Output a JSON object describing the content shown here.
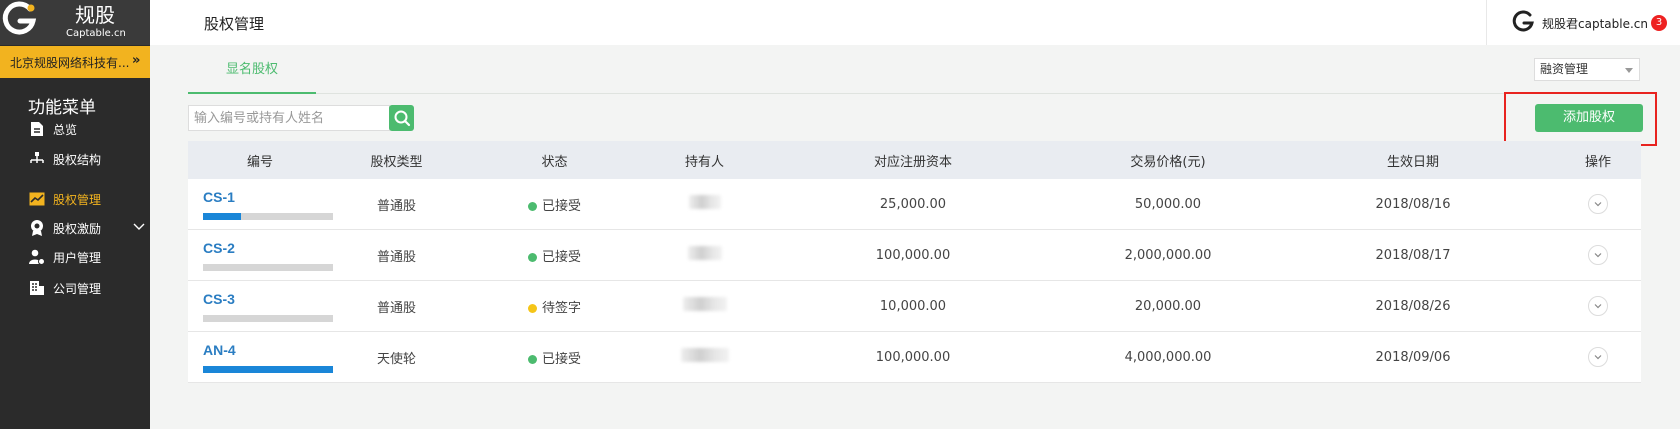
{
  "brand": {
    "name": "规股",
    "domain": "Captable.cn",
    "accent": "#f2b31f"
  },
  "company": {
    "name": "北京规股网络科技有...",
    "toggle_icon": "double-chevron-right-icon"
  },
  "sidebar": {
    "title": "功能菜单",
    "items": [
      {
        "label": "总览",
        "icon": "document-icon",
        "active": false
      },
      {
        "label": "股权结构",
        "icon": "org-chart-icon",
        "active": false
      },
      {
        "label": "股权管理",
        "icon": "trend-chart-icon",
        "active": true
      },
      {
        "label": "股权激励",
        "icon": "award-icon",
        "active": false,
        "expandable": true
      },
      {
        "label": "用户管理",
        "icon": "user-settings-icon",
        "active": false
      },
      {
        "label": "公司管理",
        "icon": "building-icon",
        "active": false
      }
    ]
  },
  "header": {
    "title": "股权管理",
    "user_name": "规股君captable.cn",
    "notification_count": "3"
  },
  "tabs": [
    {
      "label": "显名股权",
      "active": true
    }
  ],
  "finance_select": {
    "value": "融资管理"
  },
  "search": {
    "placeholder": "输入编号或持有人姓名"
  },
  "actions": {
    "add_label": "添加股权"
  },
  "colors": {
    "green": "#4cbb6f",
    "blue": "#2a7dc2",
    "progress": "#1a86d8",
    "pending": "#f5c518",
    "highlight": "#e8231f"
  },
  "table": {
    "headers": [
      "编号",
      "股权类型",
      "状态",
      "持有人",
      "对应注册资本",
      "交易价格(元)",
      "生效日期",
      "操作"
    ],
    "rows": [
      {
        "id": "CS-1",
        "progress": 0.29,
        "type": "普通股",
        "status": "已接受",
        "status_color": "#4cbb6f",
        "capital": "25,000.00",
        "price": "50,000.00",
        "date": "2018/08/16"
      },
      {
        "id": "CS-2",
        "progress": 0.0,
        "type": "普通股",
        "status": "已接受",
        "status_color": "#4cbb6f",
        "capital": "100,000.00",
        "price": "2,000,000.00",
        "date": "2018/08/17"
      },
      {
        "id": "CS-3",
        "progress": 0.0,
        "type": "普通股",
        "status": "待签字",
        "status_color": "#f5c518",
        "capital": "10,000.00",
        "price": "20,000.00",
        "date": "2018/08/26"
      },
      {
        "id": "AN-4",
        "progress": 1.0,
        "type": "天使轮",
        "status": "已接受",
        "status_color": "#4cbb6f",
        "capital": "100,000.00",
        "price": "4,000,000.00",
        "date": "2018/09/06"
      }
    ]
  }
}
